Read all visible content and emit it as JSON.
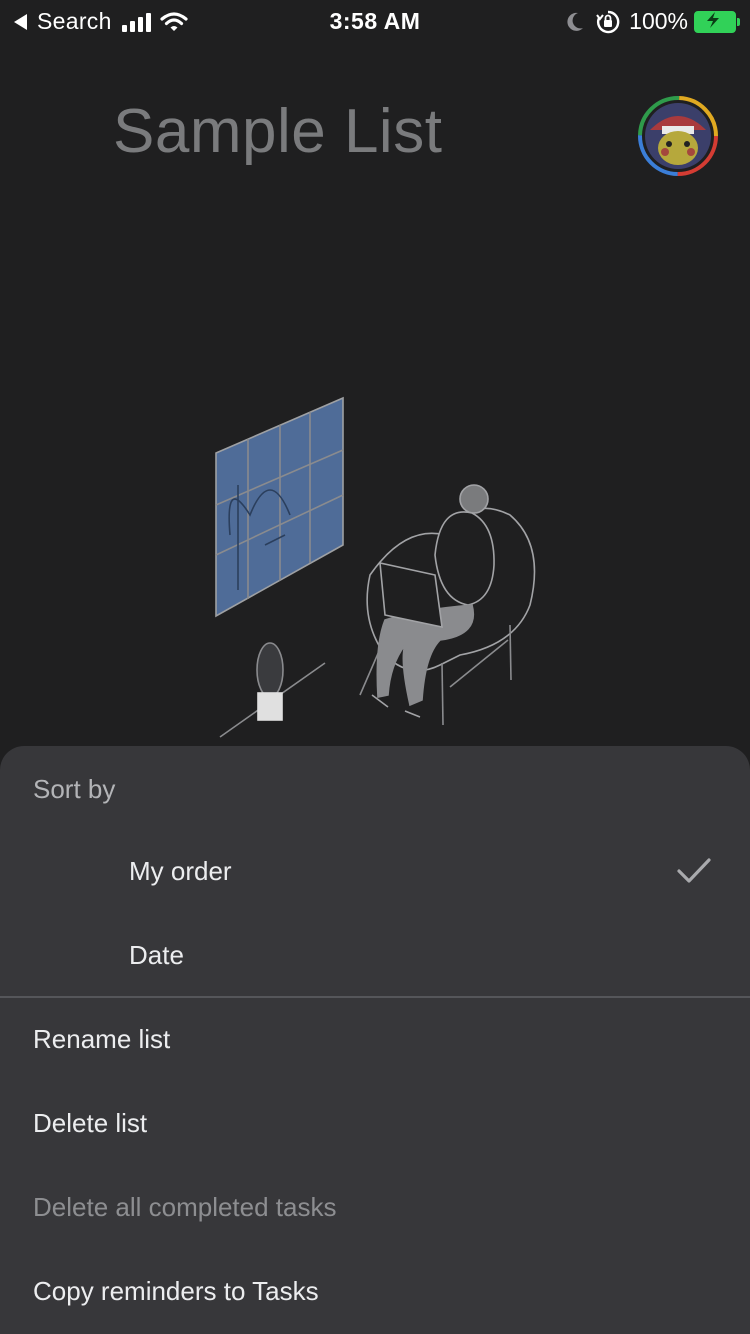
{
  "status_bar": {
    "back_label": "Search",
    "time": "3:58 AM",
    "battery_percent": "100%",
    "battery_color": "#31d158"
  },
  "header": {
    "title": "Sample List",
    "avatar_icon": "profile-avatar"
  },
  "illustration": {
    "subject": "person-in-chair-reading-by-window",
    "window_color": "#5a79a8"
  },
  "sort_menu": {
    "section_label": "Sort by",
    "options": [
      {
        "label": "My order",
        "selected": true
      },
      {
        "label": "Date",
        "selected": false
      }
    ],
    "check_icon": "checkmark-icon"
  },
  "actions": [
    {
      "label": "Rename list",
      "enabled": true
    },
    {
      "label": "Delete list",
      "enabled": true
    },
    {
      "label": "Delete all completed tasks",
      "enabled": false
    },
    {
      "label": "Copy reminders to Tasks",
      "enabled": true
    }
  ],
  "colors": {
    "background": "#1f1f20",
    "sheet": "#37373a",
    "text_primary": "#ecedef",
    "text_disabled": "#8d8e91"
  }
}
